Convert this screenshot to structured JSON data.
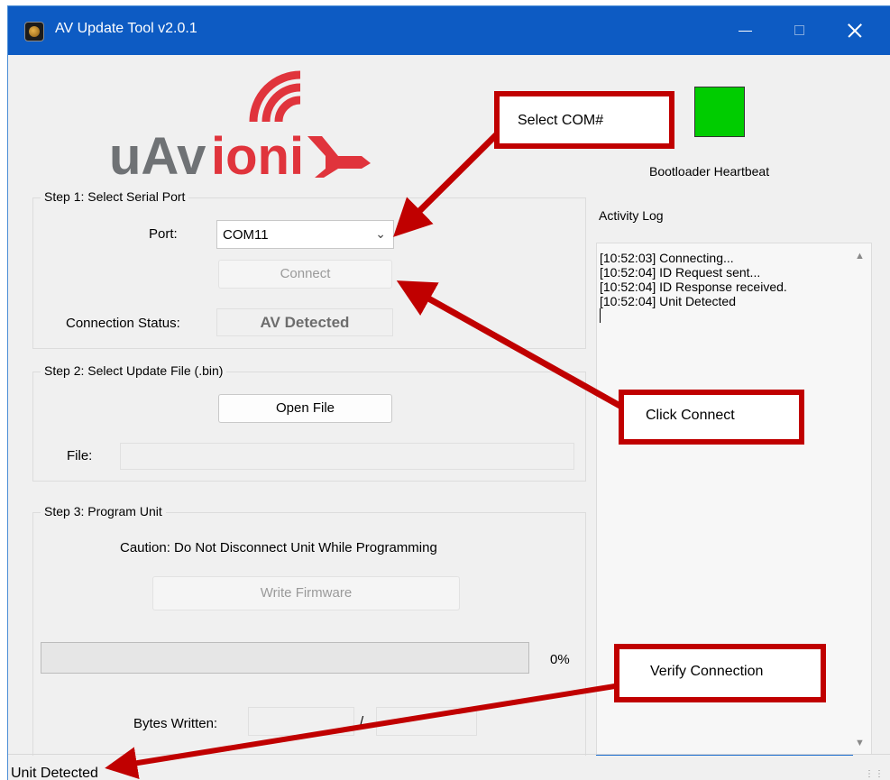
{
  "window": {
    "title": "AV Update Tool v2.0.1"
  },
  "logo": {
    "text_gray": "uAv",
    "text_red": "ioni",
    "brand_gray": "#6f7275",
    "brand_red": "#e0343c"
  },
  "step1": {
    "title": "Step 1: Select Serial Port",
    "port_label": "Port:",
    "port_value": "COM11",
    "connect_label": "Connect",
    "status_label": "Connection Status:",
    "status_value": "AV Detected"
  },
  "step2": {
    "title": "Step 2: Select Update File (.bin)",
    "open_label": "Open File",
    "file_label": "File:",
    "file_value": ""
  },
  "step3": {
    "title": "Step 3: Program Unit",
    "caution": "Caution: Do Not Disconnect Unit While Programming",
    "write_label": "Write Firmware",
    "progress_text": "0%",
    "progress_value": 0,
    "bytes_label": "Bytes Written:",
    "separator": "/"
  },
  "heartbeat": {
    "label": "Bootloader Heartbeat",
    "color": "#00cc00"
  },
  "log": {
    "label": "Activity Log",
    "lines": [
      "[10:52:03] Connecting...",
      "[10:52:04] ID Request sent...",
      "[10:52:04] ID Response received.",
      "[10:52:04] Unit Detected"
    ]
  },
  "statusbar": {
    "text": "Unit Detected"
  },
  "annotations": {
    "select_com": "Select COM#",
    "click_connect": "Click Connect",
    "verify": "Verify Connection",
    "color": "#c00000"
  }
}
